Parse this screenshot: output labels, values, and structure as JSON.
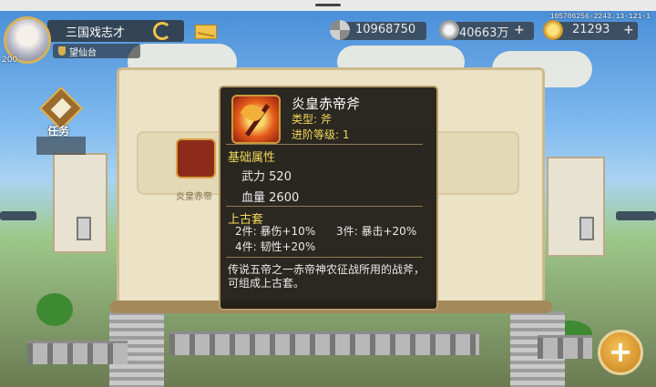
{
  "build_id": "105706256-2243.13-121-1",
  "player": {
    "name": "三国戏志才",
    "server": "望仙台",
    "level": "200"
  },
  "resources": [
    {
      "icon": "crossed-swords-icon",
      "value": "10968750"
    },
    {
      "icon": "silver-coin-icon",
      "value": "40663万"
    },
    {
      "icon": "gold-ingot-icon",
      "value": "21293"
    }
  ],
  "task": {
    "label": "任务"
  },
  "background_item": {
    "name": "炎皇赤帝"
  },
  "item": {
    "name": "炎皇赤帝斧",
    "type_label": "类型:",
    "type_value": "斧",
    "rank_label": "进阶等级:",
    "rank_value": "1",
    "base_title": "基础属性",
    "stats": [
      {
        "label": "武力",
        "value": "520"
      },
      {
        "label": "血量",
        "value": "2600"
      }
    ],
    "set_title": "上古套",
    "set_bonuses": [
      {
        "text": "2件: 暴伤+10%"
      },
      {
        "text": "3件: 暴击+20%"
      },
      {
        "text": "4件: 韧性+20%"
      }
    ],
    "description": "传说五帝之一赤帝神农征战所用的战斧，可组成上古套。"
  },
  "add_button": {
    "icon": "plus-icon"
  }
}
